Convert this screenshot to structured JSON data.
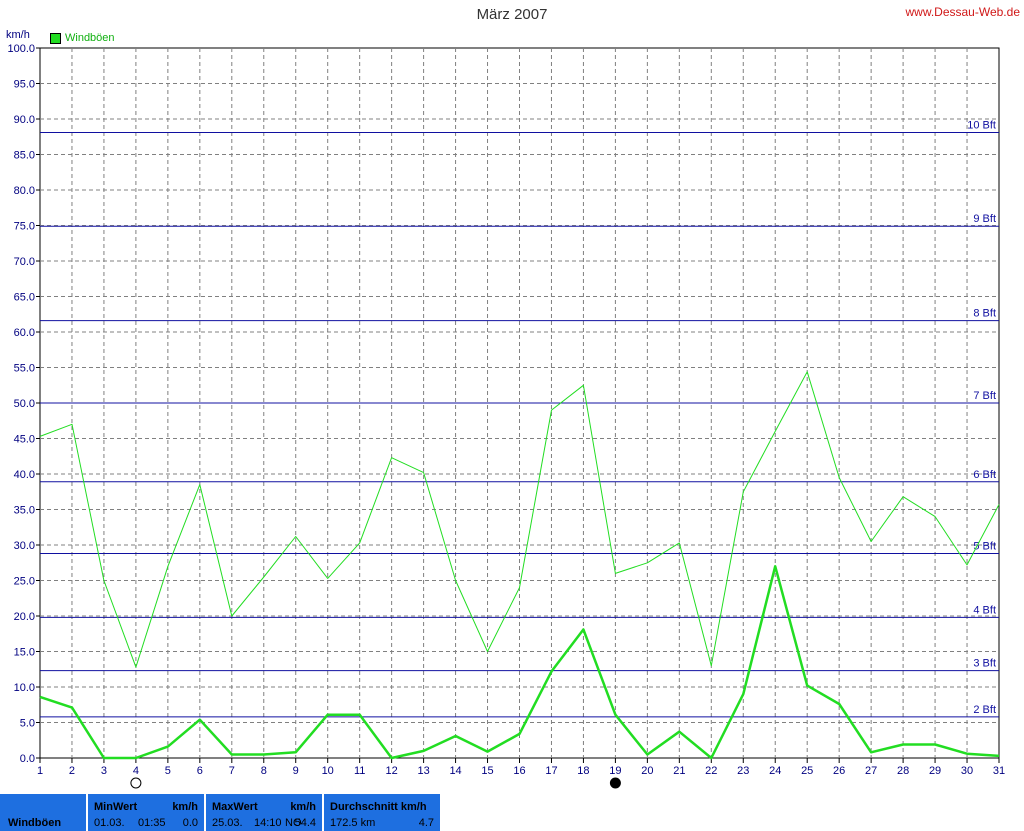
{
  "header": {
    "title": "März 2007",
    "site": "www.Dessau-Web.de",
    "unit": "km/h",
    "legend": "Windböen"
  },
  "colors": {
    "line": "#22dd22",
    "beaufort": "#1010a0",
    "axis": "#000080",
    "grid": "#808080",
    "footer": "#1e6fe0"
  },
  "chart_data": {
    "type": "line",
    "title": "März 2007",
    "ylabel": "km/h",
    "xlabel": "",
    "ylim": [
      0,
      100
    ],
    "grid": true,
    "legend_position": "top-left",
    "x": [
      1,
      2,
      3,
      4,
      5,
      6,
      7,
      8,
      9,
      10,
      11,
      12,
      13,
      14,
      15,
      16,
      17,
      18,
      19,
      20,
      21,
      22,
      23,
      24,
      25,
      26,
      27,
      28,
      29,
      30,
      31
    ],
    "y_ticks": [
      "0.0",
      "5.0",
      "10.0",
      "15.0",
      "20.0",
      "25.0",
      "30.0",
      "35.0",
      "40.0",
      "45.0",
      "50.0",
      "55.0",
      "60.0",
      "65.0",
      "70.0",
      "75.0",
      "80.0",
      "85.0",
      "90.0",
      "95.0",
      "100.0"
    ],
    "x_ticks": [
      "1",
      "2",
      "3",
      "4",
      "5",
      "6",
      "7",
      "8",
      "9",
      "10",
      "11",
      "12",
      "13",
      "14",
      "15",
      "16",
      "17",
      "18",
      "19",
      "20",
      "21",
      "22",
      "23",
      "24",
      "25",
      "26",
      "27",
      "28",
      "29",
      "30",
      "31"
    ],
    "series": [
      {
        "name": "Windböen",
        "values": [
          45.3,
          47.0,
          25.0,
          12.8,
          27.0,
          38.5,
          20.0,
          25.5,
          31.2,
          25.3,
          30.3,
          42.3,
          40.2,
          25.0,
          15.0,
          24.0,
          49.0,
          52.5,
          26.0,
          27.5,
          30.3,
          13.0,
          37.5,
          46.0,
          54.4,
          39.5,
          30.5,
          36.8,
          34.0,
          27.2,
          35.7
        ]
      },
      {
        "values": [
          8.6,
          7.1,
          0.0,
          0.0,
          1.6,
          5.4,
          0.5,
          0.5,
          0.8,
          6.1,
          6.1,
          0.0,
          1.0,
          3.1,
          0.9,
          3.4,
          12.2,
          18.1,
          6.1,
          0.5,
          3.7,
          0.0,
          9.0,
          27.0,
          10.2,
          7.6,
          0.8,
          1.9,
          1.9,
          0.6,
          0.3
        ]
      }
    ],
    "beaufort": [
      {
        "label": "2 Bft",
        "value": 5.8
      },
      {
        "label": "3 Bft",
        "value": 12.3
      },
      {
        "label": "4 Bft",
        "value": 19.8
      },
      {
        "label": "5 Bft",
        "value": 28.8
      },
      {
        "label": "6 Bft",
        "value": 38.9
      },
      {
        "label": "7 Bft",
        "value": 50.0
      },
      {
        "label": "8 Bft",
        "value": 61.6
      },
      {
        "label": "9 Bft",
        "value": 74.9
      },
      {
        "label": "10 Bft",
        "value": 88.1
      }
    ],
    "moon_markers": [
      {
        "day": 4,
        "icon": "full-moon-icon"
      },
      {
        "day": 19,
        "icon": "new-moon-icon"
      }
    ]
  },
  "footer": {
    "row_label": "Windböen",
    "min": {
      "title": "MinWert",
      "unit": "km/h",
      "date": "01.03.",
      "time": "01:35",
      "value": "0.0"
    },
    "max": {
      "title": "MaxWert",
      "unit": "km/h",
      "date": "25.03.",
      "time": "14:10",
      "dir": "NO",
      "value": "54.4"
    },
    "avg": {
      "title": "Durchschnitt km/h",
      "distance": "172.5 km",
      "value": "4.7"
    }
  }
}
